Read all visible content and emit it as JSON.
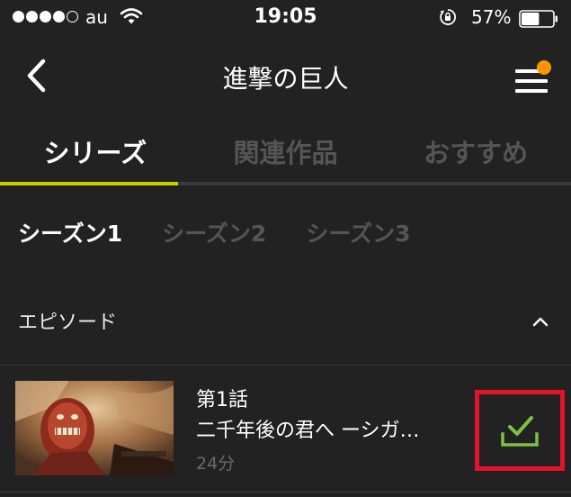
{
  "status_bar": {
    "carrier": "au",
    "time": "19:05",
    "battery_percent": "57%",
    "signal_bars_filled": 4,
    "signal_bars_total": 5,
    "battery_level": 0.57
  },
  "nav": {
    "title": "進撃の巨人",
    "back_icon": "chevron-left-icon",
    "menu_icon": "hamburger-menu-icon",
    "menu_badge_color": "#ff9500"
  },
  "tabs": [
    {
      "label": "シリーズ",
      "active": true
    },
    {
      "label": "関連作品",
      "active": false
    },
    {
      "label": "おすすめ",
      "active": false
    }
  ],
  "tab_accent_color": "#c8d100",
  "seasons": [
    {
      "label": "シーズン1",
      "active": true
    },
    {
      "label": "シーズン2",
      "active": false
    },
    {
      "label": "シーズン3",
      "active": false
    }
  ],
  "episodes_section": {
    "title": "エピソード",
    "toggle_icon": "chevron-up-icon"
  },
  "episodes": [
    {
      "number": "第1話",
      "title": "二千年後の君へ ーシガ…",
      "duration": "24分",
      "download_icon": "download-complete-icon",
      "download_icon_color": "#7cc242",
      "highlight_color": "#e3132b"
    }
  ]
}
